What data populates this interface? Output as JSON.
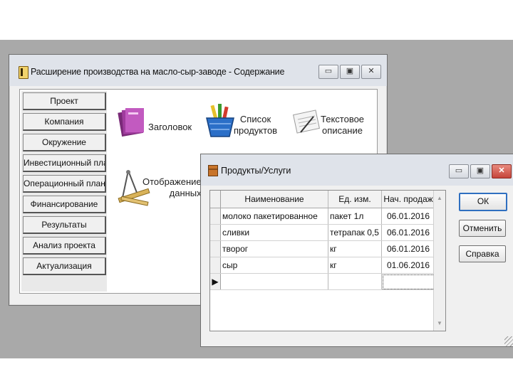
{
  "main_window": {
    "title": "Расширение производства на масло-сыр-заводе - Содержание",
    "controls": {
      "minimize": "▭",
      "restore": "▣",
      "close": "✕"
    },
    "nav": [
      "Проект",
      "Компания",
      "Окружение",
      "Инвестиционный план",
      "Операционный план",
      "Финансирование",
      "Результаты",
      "Анализ проекта",
      "Актуализация"
    ],
    "tiles": {
      "header": "Заголовок",
      "products_line1": "Список",
      "products_line2": "продуктов",
      "text_line1": "Текстовое",
      "text_line2": "описание",
      "display_line1": "Отображение",
      "display_line2": "данных"
    }
  },
  "dialog": {
    "title": "Продукты/Услуги",
    "controls": {
      "minimize": "▭",
      "restore": "▣",
      "close": "✕"
    },
    "grid": {
      "columns": [
        "Наименование",
        "Ед. изм.",
        "Нач. продаж"
      ],
      "rows": [
        [
          "молоко пакетированное",
          "пакет 1л",
          "06.01.2016"
        ],
        [
          "сливки",
          "тетрапак 0,5",
          "06.01.2016"
        ],
        [
          "творог",
          "кг",
          "06.01.2016"
        ],
        [
          "сыр",
          "кг",
          "01.06.2016"
        ]
      ],
      "new_row_marker": "▶"
    },
    "buttons": {
      "ok": "ОК",
      "cancel": "Отменить",
      "help": "Справка"
    }
  }
}
